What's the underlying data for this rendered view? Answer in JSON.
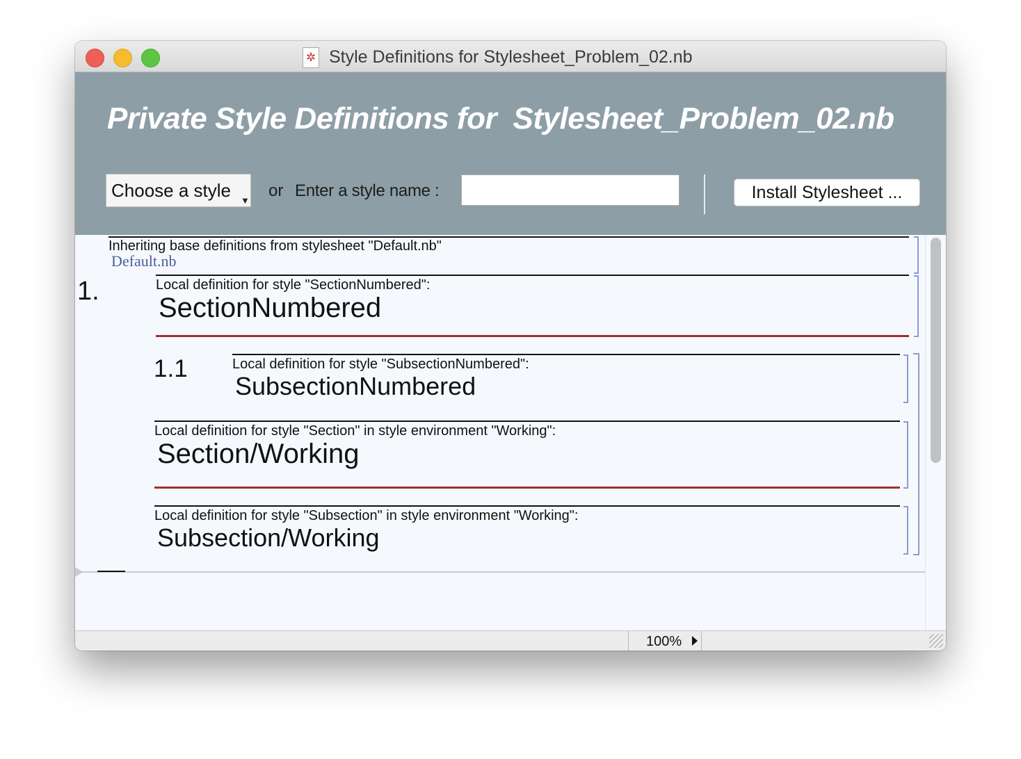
{
  "window": {
    "title": "Style Definitions for Stylesheet_Problem_02.nb",
    "doc_icon": "✲"
  },
  "header": {
    "title": "Private Style Definitions for  Stylesheet_Problem_02.nb",
    "style_menu_label": "Choose a style",
    "style_menu_chevron": "▼",
    "or_label": "or",
    "name_label": "Enter a style name :",
    "name_value": "",
    "install_label": "Install Stylesheet ..."
  },
  "content": {
    "inherit_text": "Inheriting base definitions from stylesheet \"Default.nb\"",
    "inherit_link": "Default.nb",
    "cells": [
      {
        "number": "1.",
        "desc": "Local definition for style \"SectionNumbered\":",
        "name": "SectionNumbered"
      },
      {
        "number": "1.1",
        "desc": "Local definition for style \"SubsectionNumbered\":",
        "name": "SubsectionNumbered"
      },
      {
        "number": "",
        "desc": "Local definition for style \"Section\" in style environment \"Working\":",
        "name": "Section/Working"
      },
      {
        "number": "",
        "desc": "Local definition for style \"Subsection\" in style environment \"Working\":",
        "name": "Subsection/Working"
      }
    ]
  },
  "status": {
    "zoom": "100%"
  },
  "colors": {
    "header_bg": "#8e9ea6",
    "content_bg": "#f5f9fd",
    "section_rule": "#a2302a",
    "cell_bracket": "#8a9ad2",
    "link": "#4a5d9c"
  }
}
